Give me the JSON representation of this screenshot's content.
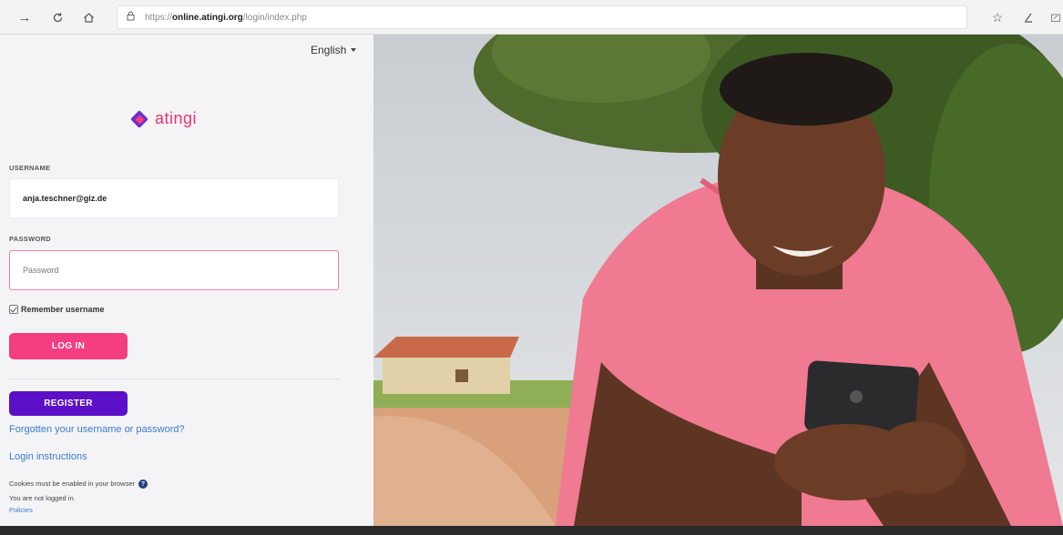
{
  "browser": {
    "url_protocol": "https://",
    "url_host": "online.atingi.org",
    "url_path": "/login/index.php"
  },
  "login": {
    "language": "English",
    "logo_text": "atingi",
    "username_label": "USERNAME",
    "username_value": "anja.teschner@giz.de",
    "password_label": "PASSWORD",
    "password_placeholder": "Password",
    "remember_label": "Remember username",
    "login_button": "LOG IN",
    "register_button": "REGISTER",
    "forgot_link": "Forgotten your username or password?",
    "instructions_link": "Login instructions",
    "cookies_text": "Cookies must be enabled in your browser",
    "not_logged_in": "You are not logged in.",
    "policies_link": "Policies"
  },
  "colors": {
    "brand_pink": "#f43d80",
    "brand_purple": "#5b0fc7",
    "link_blue": "#3a7bd5"
  }
}
